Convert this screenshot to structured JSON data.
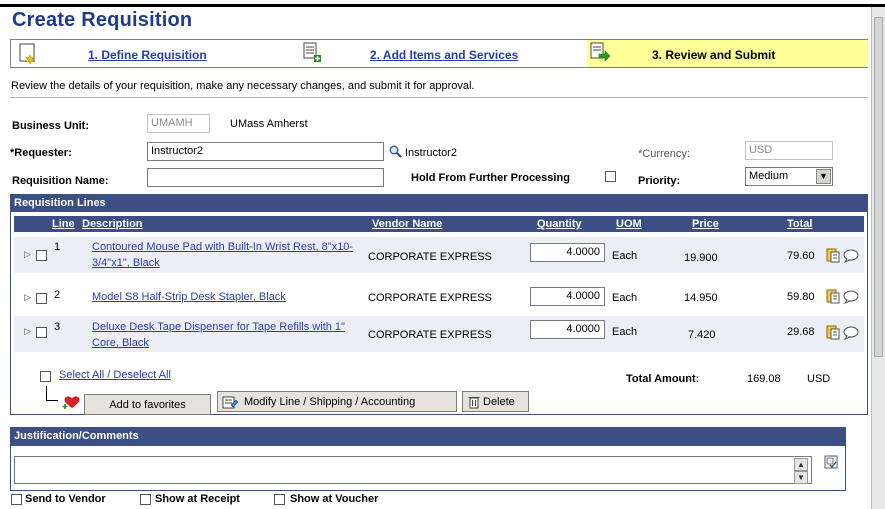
{
  "page": {
    "title": "Create Requisition",
    "instructions": "Review the details of your requisition, make any necessary changes, and submit it for approval."
  },
  "steps": [
    {
      "label": "1. Define Requisition"
    },
    {
      "label": "2. Add Items and Services"
    },
    {
      "label": "3. Review and Submit"
    }
  ],
  "header_form": {
    "business_unit_label": "Business Unit:",
    "business_unit_value": "UMAMH",
    "business_unit_name": "UMass Amherst",
    "requester_label": "*Requester:",
    "requester_value": "Instructor2",
    "requester_name": "Instructor2",
    "currency_label": "*Currency:",
    "currency_value": "USD",
    "requisition_name_label": "Requisition Name:",
    "requisition_name_value": "",
    "hold_label": "Hold From Further Processing",
    "priority_label": "Priority:",
    "priority_value": "Medium"
  },
  "lines": {
    "section_title": "Requisition Lines",
    "columns": [
      "Line",
      "Description",
      "Vendor Name",
      "Quantity",
      "UOM",
      "Price",
      "Total"
    ],
    "rows": [
      {
        "line": "1",
        "description": "Contoured Mouse Pad with Built-In Wrist Rest, 8\"x10-3/4\"x1\", Black",
        "vendor": "CORPORATE EXPRESS",
        "quantity": "4.0000",
        "uom": "Each",
        "price": "19.900",
        "total": "79.60"
      },
      {
        "line": "2",
        "description": "Model S8 Half-Strip Desk Stapler, Black",
        "vendor": "CORPORATE EXPRESS",
        "quantity": "4.0000",
        "uom": "Each",
        "price": "14.950",
        "total": "59.80"
      },
      {
        "line": "3",
        "description": "Deluxe Desk Tape Dispenser for Tape Refills with 1\" Core, Black",
        "vendor": "CORPORATE EXPRESS",
        "quantity": "4.0000",
        "uom": "Each",
        "price": "7.420",
        "total": "29.68"
      }
    ],
    "select_all": "Select All / Deselect All",
    "total_amount_label": "Total Amount:",
    "total_amount_value": "169.08",
    "total_amount_currency": "USD",
    "add_to_favorites": "Add to favorites",
    "modify_line": "Modify Line / Shipping / Accounting",
    "delete": "Delete"
  },
  "comments": {
    "section_title": "Justification/Comments",
    "value": "",
    "send_to_vendor": "Send to Vendor",
    "show_at_receipt": "Show at Receipt",
    "show_at_voucher": "Show at Voucher"
  },
  "colors": {
    "header_blue": "#3c4f84",
    "title_blue": "#1f3c8c",
    "link_blue": "#2a3cad",
    "step_highlight": "#ffff99",
    "row_band": "#eceef6"
  },
  "icons": {
    "step1": "define-requisition-icon",
    "step2": "add-items-icon",
    "step3": "review-submit-icon",
    "lookup": "magnifier-icon",
    "line_details": "schedule-icon",
    "line_comments": "comment-bubble-icon",
    "favorites": "heart-plus-icon",
    "modify": "modify-line-icon",
    "delete": "trash-icon",
    "spellcheck": "spellcheck-icon"
  }
}
